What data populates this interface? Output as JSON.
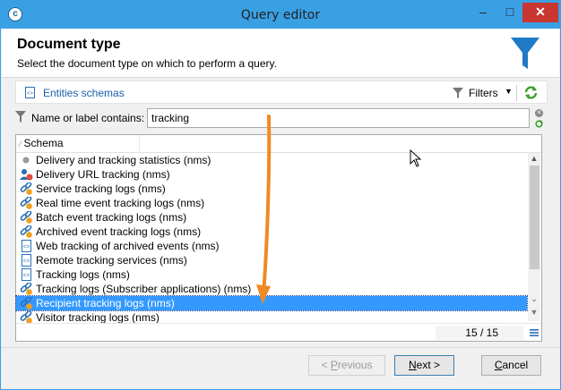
{
  "window": {
    "title": "Query editor",
    "app_icon": "adobe-campaign-icon",
    "controls": [
      "minimize",
      "maximize",
      "close"
    ]
  },
  "header": {
    "title": "Document type",
    "subtitle": "Select the document type on which to perform a query.",
    "icon": "funnel-icon"
  },
  "toolbar": {
    "schemas_label": "Entities schemas",
    "filters_label": "Filters"
  },
  "filter": {
    "label": "Name or label contains:",
    "value": "tracking"
  },
  "list": {
    "column_header": "Schema",
    "rows": [
      {
        "label": "Delivery and tracking statistics (nms)",
        "icon": "gray-dot-icon"
      },
      {
        "label": "Delivery URL tracking (nms)",
        "icon": "user-link-icon"
      },
      {
        "label": "Service tracking logs (nms)",
        "icon": "link-chain-icon"
      },
      {
        "label": "Real time event tracking logs (nms)",
        "icon": "link-chain-icon"
      },
      {
        "label": "Batch event tracking logs (nms)",
        "icon": "link-chain-icon"
      },
      {
        "label": "Archived event tracking logs (nms)",
        "icon": "link-chain-icon"
      },
      {
        "label": "Web tracking of archived events (nms)",
        "icon": "schema-doc-icon"
      },
      {
        "label": "Remote tracking services (nms)",
        "icon": "schema-doc-icon"
      },
      {
        "label": "Tracking logs (nms)",
        "icon": "schema-doc-icon"
      },
      {
        "label": "Tracking logs (Subscriber applications) (nms)",
        "icon": "link-chain-icon"
      },
      {
        "label": "Recipient tracking logs (nms)",
        "icon": "link-chain-icon",
        "selected": true
      },
      {
        "label": "Visitor tracking logs (nms)",
        "icon": "link-chain-icon"
      }
    ],
    "count": "15 / 15"
  },
  "footer": {
    "previous_label": "Previous",
    "previous_underline": "P",
    "next_label": "Next >",
    "next_underline": "N",
    "cancel_label": "Cancel",
    "cancel_underline": "C"
  },
  "colors": {
    "titlebar": "#3aa0e4",
    "selection": "#3399ff",
    "link": "#1d5fa8",
    "annotation_arrow": "#f08a24",
    "refresh_green": "#3a9d2a",
    "funnel_blue": "#1f7bc6"
  }
}
